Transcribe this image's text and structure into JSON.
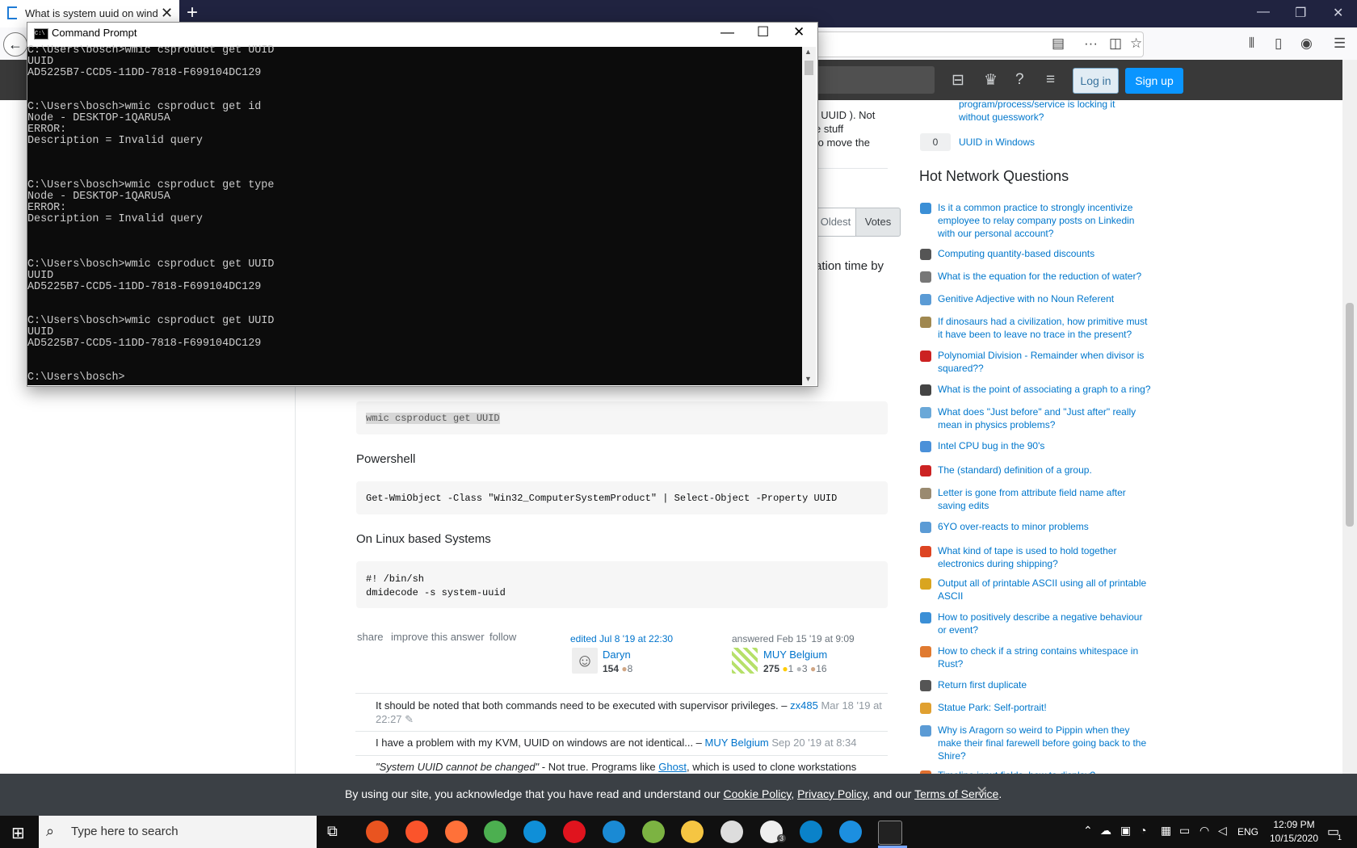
{
  "browser": {
    "tab_title": "What is system uuid on windo",
    "new_tab": "+",
    "window_controls": [
      "—",
      "❐",
      "✕"
    ]
  },
  "so_header": {
    "login_label": "Log in",
    "signup_label": "Sign up"
  },
  "answer": {
    "partial_line1": "t UUID ). Not",
    "partial_line2": "e stuff",
    "partial_line3": "to move the",
    "sort_oldest": "Oldest",
    "sort_votes": "Votes",
    "partial_text": "ation time by",
    "cmd_code": "wmic csproduct get UUID",
    "powershell_heading": "Powershell",
    "powershell_code": "Get-WmiObject -Class \"Win32_ComputerSystemProduct\" | Select-Object -Property UUID",
    "linux_heading": "On Linux based Systems",
    "linux_code_line1": "#! /bin/sh",
    "linux_code_line2": "dmidecode -s system-uuid",
    "menu_share": "share",
    "menu_improve": "improve this answer",
    "menu_follow": "follow",
    "edited_time": "edited Jul 8 '19 at 22:30",
    "editor_name": "Daryn",
    "editor_rep": "154",
    "editor_bronze": "8",
    "answered_time": "answered Feb 15 '19 at 9:09",
    "author_name": "MUY Belgium",
    "author_rep": "275",
    "author_gold": "1",
    "author_silver": "3",
    "author_bronze": "16"
  },
  "comments": [
    {
      "text": "It should be noted that both commands need to be executed with supervisor privileges. –",
      "user": "zx485",
      "time": "Mar 18 '19 at",
      "time2": "22:27"
    },
    {
      "text": "I have a problem with my KVM, UUID on windows are not identical... –",
      "user": "MUY Belgium",
      "time": "Sep 20 '19 at 8:34"
    },
    {
      "text_italic": "\"System UUID cannot be changed\"",
      "text": " - Not true. Programs like ",
      "link": "Ghost",
      "text_end": ", which is used to clone workstations"
    }
  ],
  "sidebar": {
    "linked_partial1": "program/process/service is locking it",
    "linked_partial2": "without guesswork?",
    "linked_count": "0",
    "linked_title": "UUID in Windows",
    "hnq_title": "Hot Network Questions",
    "hnq": [
      {
        "l1": "Is it a common practice to strongly incentivize",
        "l2": "employee to relay company posts on Linkedin",
        "l3": "with our personal account?",
        "color": "#3b8fd6"
      },
      {
        "l1": "Computing quantity-based discounts",
        "l2": "",
        "l3": "",
        "color": "#555555"
      },
      {
        "l1": "What is the equation for the reduction of water?",
        "l2": "",
        "l3": "",
        "color": "#777777"
      },
      {
        "l1": "Genitive Adjective with no Noun Referent",
        "l2": "",
        "l3": "",
        "color": "#5b9bd5"
      },
      {
        "l1": "If dinosaurs had a civilization, how primitive must",
        "l2": "it have been to leave no trace in the present?",
        "l3": "",
        "color": "#a08850"
      },
      {
        "l1": "Polynomial Division - Remainder when divisor is",
        "l2": "squared??",
        "l3": "",
        "color": "#cc2222"
      },
      {
        "l1": "What is the point of associating a graph to a ring?",
        "l2": "",
        "l3": "",
        "color": "#444444"
      },
      {
        "l1": "What does \"Just before\" and \"Just after\" really",
        "l2": "mean in physics problems?",
        "l3": "",
        "color": "#6aa8d8"
      },
      {
        "l1": "Intel CPU bug in the 90's",
        "l2": "",
        "l3": "",
        "color": "#4a90d9"
      },
      {
        "l1": "The (standard) definition of a group.",
        "l2": "",
        "l3": "",
        "color": "#cc2222"
      },
      {
        "l1": "Letter is gone from attribute field name after",
        "l2": "saving edits",
        "l3": "",
        "color": "#9a8a70"
      },
      {
        "l1": "6YO over-reacts to minor problems",
        "l2": "",
        "l3": "",
        "color": "#5b9bd5"
      },
      {
        "l1": "What kind of tape is used to hold together",
        "l2": "electronics during shipping?",
        "l3": "",
        "color": "#dd4422"
      },
      {
        "l1": "Output all of printable ASCII using all of printable",
        "l2": "ASCII",
        "l3": "",
        "color": "#d9a520"
      },
      {
        "l1": "How to positively describe a negative behaviour",
        "l2": "or event?",
        "l3": "",
        "color": "#3b8fd6"
      },
      {
        "l1": "How to check if a string contains whitespace in",
        "l2": "Rust?",
        "l3": "",
        "color": "#e07a30"
      },
      {
        "l1": "Return first duplicate",
        "l2": "",
        "l3": "",
        "color": "#555555"
      },
      {
        "l1": "Statue Park: Self-portrait!",
        "l2": "",
        "l3": "",
        "color": "#e0a030"
      },
      {
        "l1": "Why is Aragorn so weird to Pippin when they",
        "l2": "make their final farewell before going back to the",
        "l3": "Shire?",
        "color": "#5b9bd5"
      },
      {
        "l1": "Timeline input fields, how to display?",
        "l2": "",
        "l3": "",
        "color": "#e07030"
      }
    ]
  },
  "cookie": {
    "text1": "By using our site, you acknowledge that you have read and understand our ",
    "cookie_policy": "Cookie Policy",
    "sep1": ", ",
    "privacy_policy": "Privacy Policy",
    "sep2": ", and our ",
    "terms": "Terms of Service",
    "end": ".",
    "close": "✕"
  },
  "cmd": {
    "title": "Command Prompt",
    "icon_text": "C:\\",
    "lines": "C:\\Users\\bosch>wmic csproduct get UUID\nUUID\nAD5225B7-CCD5-11DD-7818-F699104DC129\n\n\nC:\\Users\\bosch>wmic csproduct get id\nNode - DESKTOP-1QARU5A\nERROR:\nDescription = Invalid query\n\n\n\nC:\\Users\\bosch>wmic csproduct get type\nNode - DESKTOP-1QARU5A\nERROR:\nDescription = Invalid query\n\n\n\nC:\\Users\\bosch>wmic csproduct get UUID\nUUID\nAD5225B7-CCD5-11DD-7818-F699104DC129\n\n\nC:\\Users\\bosch>wmic csproduct get UUID\nUUID\nAD5225B7-CCD5-11DD-7818-F699104DC129\n\n\nC:\\Users\\bosch>"
  },
  "taskbar": {
    "search_placeholder": "Type here to search",
    "lang": "ENG",
    "time": "12:09 PM",
    "date": "10/15/2020",
    "mail_badge": "3",
    "notif_badge": "1",
    "apps": [
      {
        "name": "ubuntu-icon",
        "color": "#e95420"
      },
      {
        "name": "brave-icon",
        "color": "#fb542b"
      },
      {
        "name": "firefox-icon",
        "color": "#ff7139"
      },
      {
        "name": "chrome-icon",
        "color": "#4caf50"
      },
      {
        "name": "edge-icon",
        "color": "#0f8fd8"
      },
      {
        "name": "opera-icon",
        "color": "#e0141e"
      },
      {
        "name": "vscode-icon",
        "color": "#1a8ad4"
      },
      {
        "name": "notepad-icon",
        "color": "#7cb342"
      },
      {
        "name": "file-explorer-icon",
        "color": "#f5c542"
      },
      {
        "name": "store-icon",
        "color": "#dddddd"
      },
      {
        "name": "mail-icon",
        "color": "#eeeeee"
      },
      {
        "name": "nextcloud-icon",
        "color": "#0a82c9"
      },
      {
        "name": "clock-app-icon",
        "color": "#1c8fe0"
      },
      {
        "name": "cmd-app-icon",
        "color": "#222222"
      }
    ]
  }
}
